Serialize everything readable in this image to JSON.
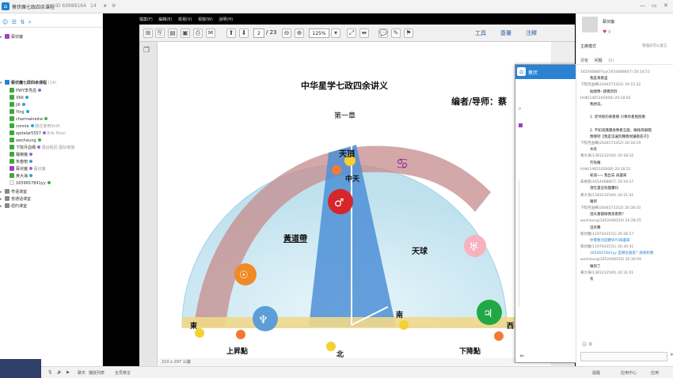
{
  "window": {
    "title": "蔡伏魔七政四余课程",
    "room_id": "ID 69988164",
    "member_count": "14",
    "controls": [
      "—",
      "▭",
      "✕"
    ]
  },
  "left": {
    "top_user": "蔡伏魔",
    "groups": [
      {
        "label": "蔡伏魔七政四余课程",
        "count": "(14)"
      },
      {
        "label": "粤语课室"
      },
      {
        "label": "普通话课室"
      },
      {
        "label": "纽约课室"
      }
    ],
    "members": [
      {
        "name": "PWY李亮岳",
        "note": ""
      },
      {
        "name": "XKK",
        "note": ""
      },
      {
        "name": "Jill",
        "note": ""
      },
      {
        "name": "Ying",
        "note": ""
      },
      {
        "name": "charmaineine",
        "note": ""
      },
      {
        "name": "connie",
        "note": "我在使用Shift"
      },
      {
        "name": "epitelar5557",
        "note": "Erik Peon"
      },
      {
        "name": "wecheung",
        "note": ""
      },
      {
        "name": "下院月血细",
        "note": "遇远程回 图标链接"
      },
      {
        "name": "睡懒猪",
        "note": ""
      },
      {
        "name": "朱春丽",
        "note": ""
      },
      {
        "name": "蔡伏魔",
        "note": "蔡伏魔"
      },
      {
        "name": "黄大海",
        "note": ""
      },
      {
        "name": "1659657841yy",
        "note": ""
      }
    ]
  },
  "pdf": {
    "menu": [
      "檔案(F)",
      "編輯(E)",
      "檢視(V)",
      "視窗(W)",
      "說明(H)"
    ],
    "page_current": "2",
    "page_total": "/ 23",
    "zoom": "125%",
    "links": [
      "工具",
      "簽署",
      "注釋"
    ],
    "status": "210 x 297 公釐",
    "title": "中华星学七政四余讲义",
    "author": "编者/导师：蔡",
    "chapter": "第一章",
    "diagram_labels": {
      "top": "天頂",
      "center": "中天",
      "ecliptic": "黃道帶",
      "sphere": "天球",
      "south": "南",
      "east": "東",
      "west": "西",
      "north": "北",
      "ascendant": "上昇點",
      "descendant": "下降點"
    }
  },
  "overlay": {
    "title": "蔡伏"
  },
  "right": {
    "user": "蔡伏魔",
    "likes": "0",
    "mode": "主席模式",
    "mgmt": "管理员可以发言",
    "tabs": [
      "讨论",
      "问题"
    ],
    "question_count": "(0)",
    "chat": [
      {
        "type": "u",
        "text": "1654468807yy(1654468807) 20:14:51"
      },
      {
        "type": "t",
        "text": "我是来看里"
      },
      {
        "type": "u",
        "text": "下院月血细(2044573352) 20:15:32"
      },
      {
        "type": "t",
        "text": "贴图像--建模资料"
      },
      {
        "type": "u",
        "text": "HHK(1465102608) 20:18:02"
      },
      {
        "type": "t",
        "text": "我想说，"
      },
      {
        "type": "t",
        "text": ""
      },
      {
        "type": "t",
        "text": "1. 老师照的来看哪 只像有看图图看"
      },
      {
        "type": "t",
        "text": ""
      },
      {
        "type": "t",
        "text": "2. 不知道講課放像看怎麼，聯絡尋解閥"
      },
      {
        "type": "t",
        "text": "像哪吧【我是沒邊別種資視讓看莊子】"
      },
      {
        "type": "u",
        "text": "下院月血细(2044573352) 20:18:19"
      },
      {
        "type": "t",
        "text": "木有"
      },
      {
        "type": "u",
        "text": "黄大海(1381212540) 20:18:32"
      },
      {
        "type": "t",
        "text": "冇啦睡"
      },
      {
        "type": "u",
        "text": "HHK(1465102608) 20:18:52"
      },
      {
        "type": "t",
        "text": "知道~~ 我出去 再盡來"
      },
      {
        "type": "u",
        "text": "朱春丽(1654468807) 20:19:37"
      },
      {
        "type": "t",
        "text": "現在還沒有圖畫吗"
      },
      {
        "type": "u",
        "text": "黄大海(1381212540) 20:21:41"
      },
      {
        "type": "t",
        "text": "睡到"
      },
      {
        "type": "u",
        "text": "下院月血细(2044573352) 20:28:10"
      },
      {
        "type": "t",
        "text": "溫天重都微像黑看熟？"
      },
      {
        "type": "u",
        "text": "wecheung(1652448250) 20:28:25"
      },
      {
        "type": "t",
        "text": "沒有聲"
      },
      {
        "type": "u",
        "text": "蔡伏魔(1197443151) 20:28:57"
      },
      {
        "type": "t",
        "text": "你需要对話聽WIYI再盡來"
      },
      {
        "type": "u",
        "text": "蔡伏魔(1197443151) 20:30:31"
      },
      {
        "type": "t",
        "text": "1654657841yy 是哪位朋友？請來和我"
      },
      {
        "type": "u",
        "text": "wecheung(1652448250) 20:30:59"
      },
      {
        "type": "t",
        "text": "睡到了"
      },
      {
        "type": "u",
        "text": "黄大海(1381212540) 20:31:01"
      },
      {
        "type": "t",
        "text": "有"
      }
    ]
  },
  "bottom": {
    "items": [
      "聊天",
      "播放列表",
      "全员禁言"
    ],
    "right_items": [
      "提醒",
      "应用中心",
      "应用"
    ]
  },
  "colors": {
    "accent": "#2b82d3",
    "ecliptic_band": "#c58b8b",
    "sky": "#cfe8f3",
    "center_beam": "#4d8fd6"
  }
}
